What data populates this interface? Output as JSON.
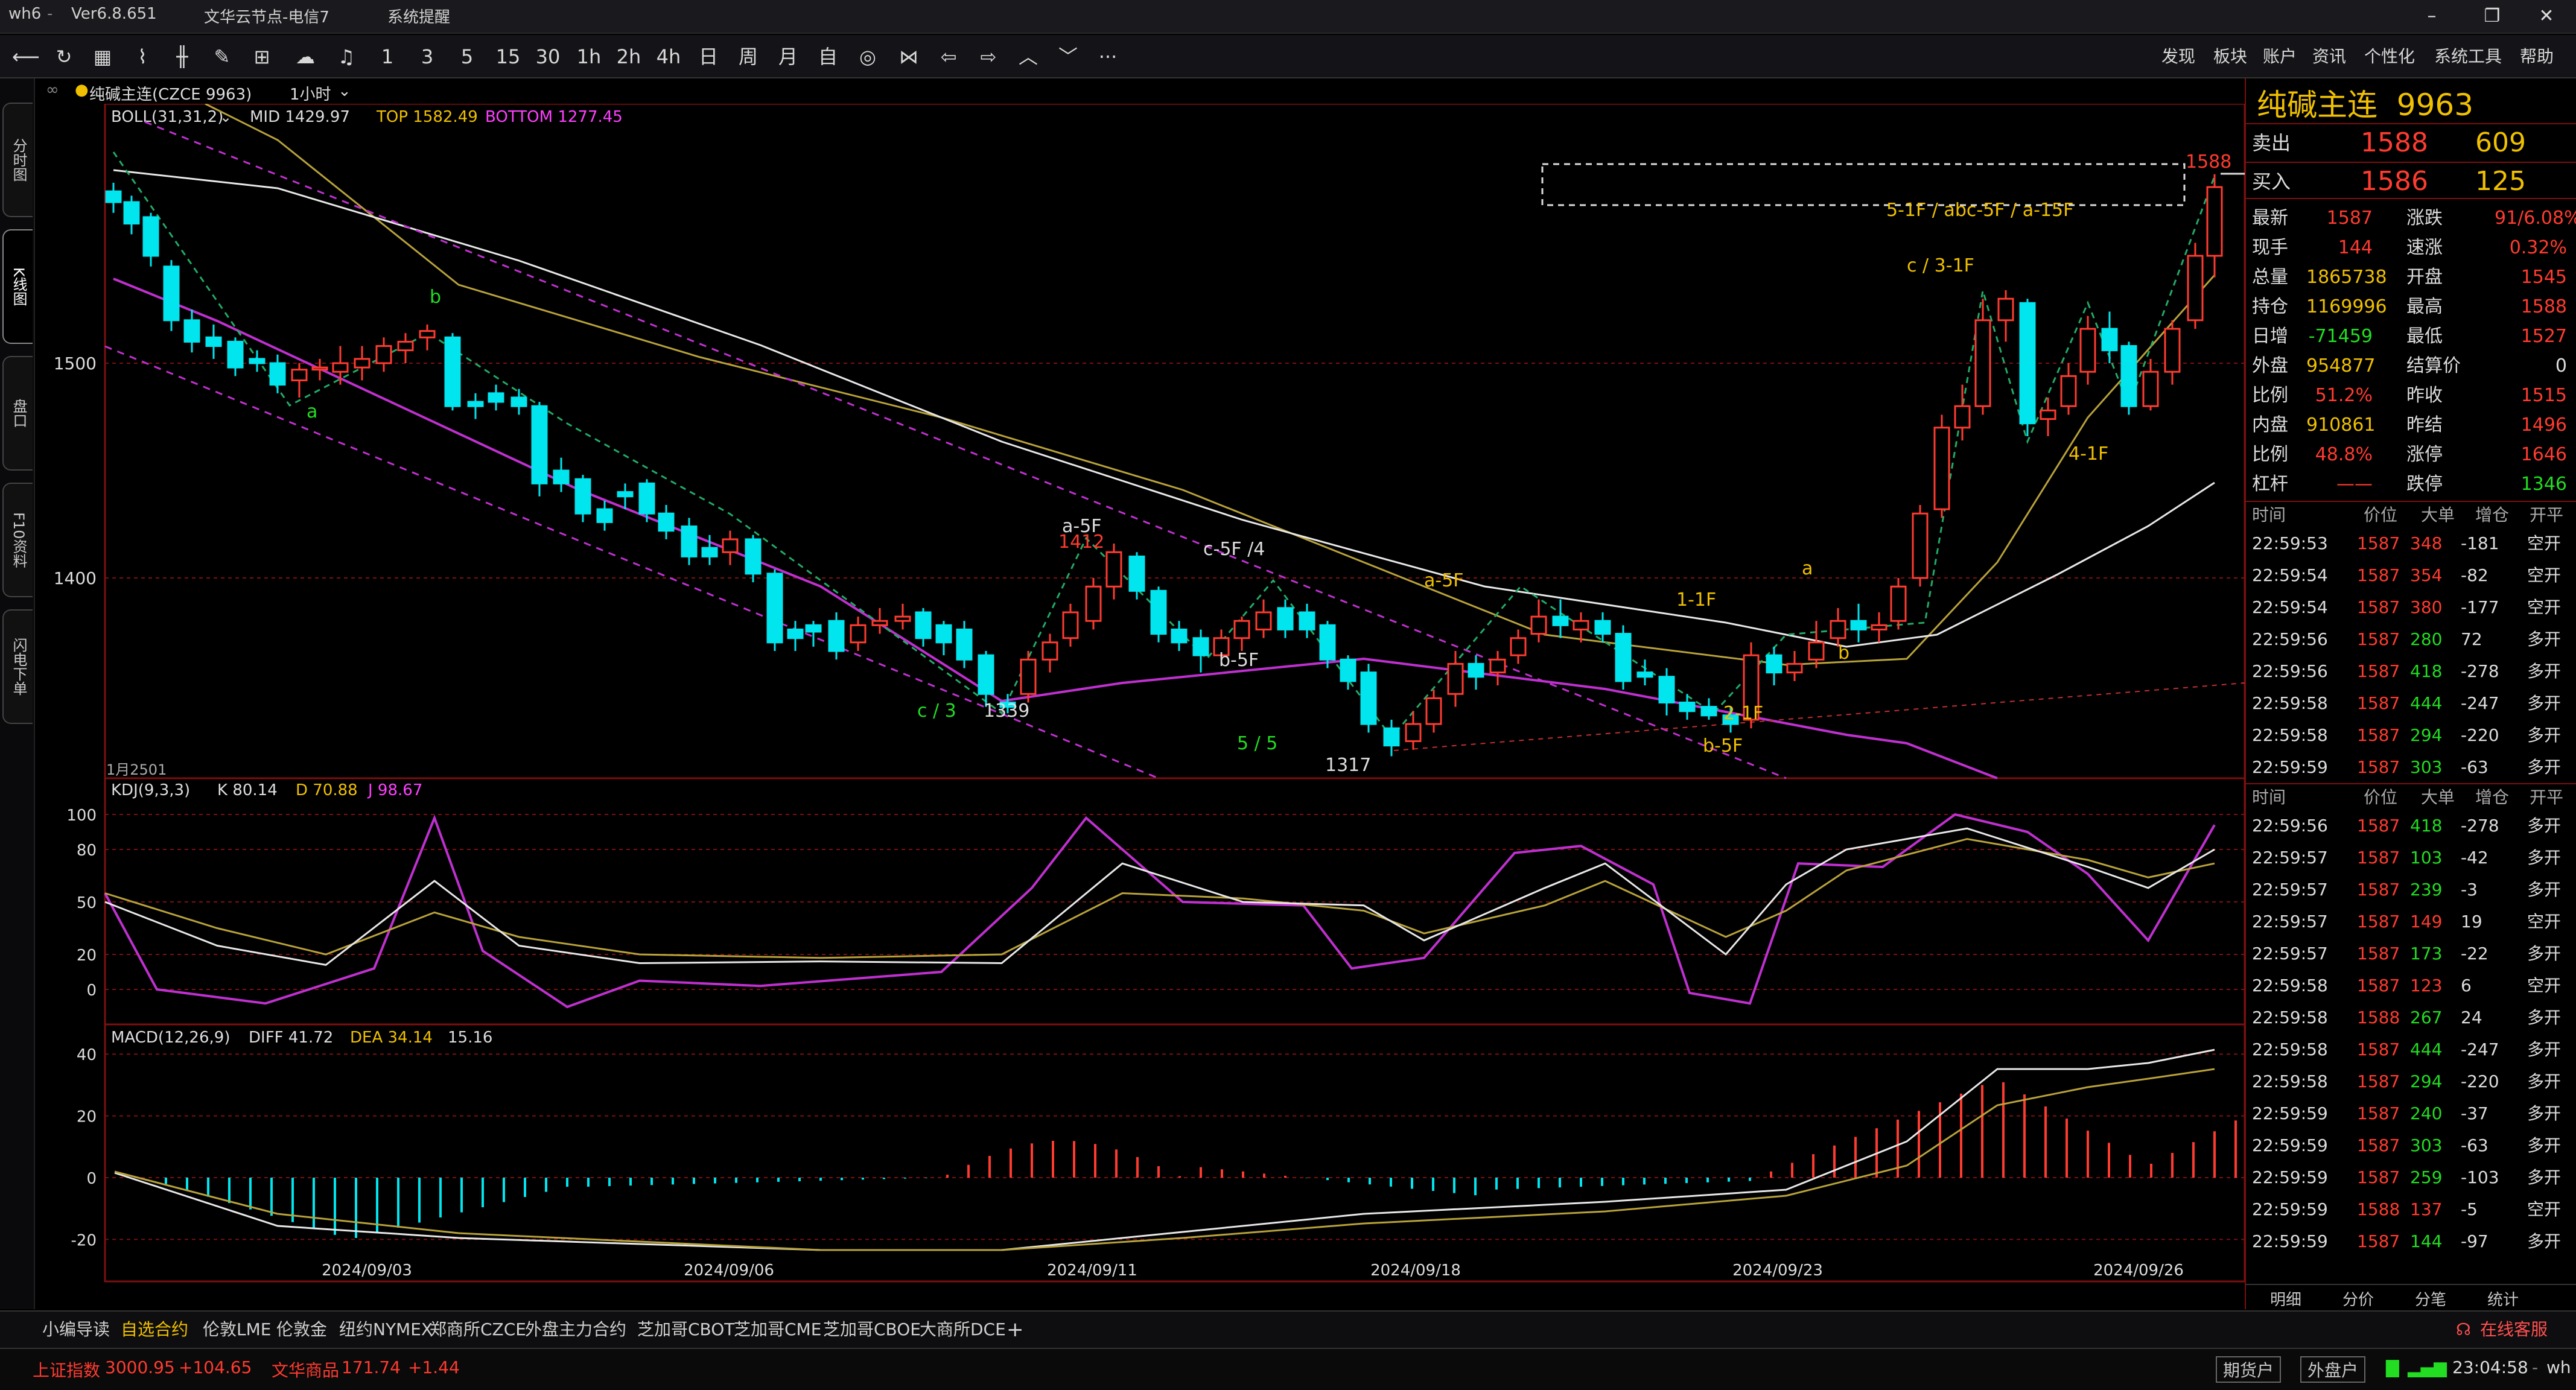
{
  "titlebar": {
    "app": "wh6",
    "version": "Ver6.8.651",
    "server": "文华云节点-电信7",
    "system": "系统提醒"
  },
  "toolbar": {
    "periods": [
      "1",
      "3",
      "5",
      "15",
      "30",
      "1h",
      "2h",
      "4h",
      "日",
      "周",
      "月",
      "自"
    ],
    "ellipsis": "···",
    "menus": [
      "发现",
      "板块",
      "账户",
      "资讯",
      "个性化",
      "系统工具",
      "帮助"
    ]
  },
  "sidetabs": [
    "分时图",
    "K线图",
    "盘口",
    "F10资料",
    "闪电下单"
  ],
  "chart": {
    "tab": "纯碱主连(CZCE 9963)",
    "period": "1小时",
    "boll": {
      "name": "BOLL(31,31,2)",
      "mid": "MID 1429.97",
      "top": "TOP 1582.49",
      "bottom": "BOTTOM 1277.45"
    },
    "kdj": {
      "name": "KDJ(9,3,3)",
      "k": "K 80.14",
      "d": "D 70.88",
      "j": "J 98.67"
    },
    "macd": {
      "name": "MACD(12,26,9)",
      "diff": "DIFF 41.72",
      "dea": "DEA 34.14",
      "hist": "15.16"
    },
    "yaxis_main": [
      "1500",
      "1400"
    ],
    "yaxis_kdj": [
      "100",
      "80",
      "50",
      "20",
      "0"
    ],
    "yaxis_macd": [
      "40",
      "20",
      "0",
      "-20"
    ],
    "xaxis": [
      "2024/09/03",
      "2024/09/06",
      "2024/09/11",
      "2024/09/18",
      "2024/09/23",
      "2024/09/26"
    ],
    "bottom_note": "1月2501",
    "annotations": {
      "a1": "a",
      "b1": "b",
      "c3": "c / 3",
      "p1339": "1339",
      "a5f": "a-5F",
      "p1412": "1412",
      "c5f": "c-5F /4",
      "b5f": "b-5F",
      "s55": "5 / 5",
      "p1317": "1317",
      "a5f2": "a-5F",
      "f1": "1-1F",
      "f2": "2-1F",
      "b5f2": "b-5F",
      "a2": "a",
      "b2": "b",
      "c3f": "c / 3-1F",
      "wave": "5-1F / abc-5F / a-15F",
      "f4": "4-1F",
      "p1588": "1588"
    }
  },
  "quote": {
    "name": "纯碱主连",
    "code": "9963",
    "sell": {
      "label": "卖出",
      "price": "1588",
      "vol": "609"
    },
    "buy": {
      "label": "买入",
      "price": "1586",
      "vol": "125"
    },
    "stats": [
      [
        "最新",
        "1587",
        "涨跌",
        "91/6.08%"
      ],
      [
        "现手",
        "144",
        "速涨",
        "0.32%"
      ],
      [
        "总量",
        "1865738",
        "开盘",
        "1545"
      ],
      [
        "持仓",
        "1169996",
        "最高",
        "1588"
      ],
      [
        "日增",
        "-71459",
        "最低",
        "1527"
      ],
      [
        "外盘",
        "954877",
        "结算价",
        "0"
      ],
      [
        "比例",
        "51.2%",
        "昨收",
        "1515"
      ],
      [
        "内盘",
        "910861",
        "昨结",
        "1496"
      ],
      [
        "比例",
        "48.8%",
        "涨停",
        "1646"
      ],
      [
        "杠杆",
        "——",
        "跌停",
        "1346"
      ]
    ],
    "th": [
      "时间",
      "价位",
      "大单",
      "增仓",
      "开平"
    ],
    "trades1": [
      [
        "22:59:53",
        "1587",
        "348",
        "-181",
        "空开"
      ],
      [
        "22:59:54",
        "1587",
        "354",
        "-82",
        "空开"
      ],
      [
        "22:59:54",
        "1587",
        "380",
        "-177",
        "空开"
      ],
      [
        "22:59:56",
        "1587",
        "280",
        "72",
        "多开"
      ],
      [
        "22:59:56",
        "1587",
        "418",
        "-278",
        "多开"
      ],
      [
        "22:59:58",
        "1587",
        "444",
        "-247",
        "多开"
      ],
      [
        "22:59:58",
        "1587",
        "294",
        "-220",
        "多开"
      ],
      [
        "22:59:59",
        "1587",
        "303",
        "-63",
        "多开"
      ]
    ],
    "th2": [
      "时间",
      "价位",
      "大单",
      "增仓",
      "开平"
    ],
    "trades2": [
      [
        "22:59:56",
        "1587",
        "418",
        "-278",
        "多开"
      ],
      [
        "22:59:57",
        "1587",
        "103",
        "-42",
        "多开"
      ],
      [
        "22:59:57",
        "1587",
        "239",
        "-3",
        "多开"
      ],
      [
        "22:59:57",
        "1587",
        "149",
        "19",
        "空开"
      ],
      [
        "22:59:57",
        "1587",
        "173",
        "-22",
        "多开"
      ],
      [
        "22:59:58",
        "1587",
        "123",
        "6",
        "空开"
      ],
      [
        "22:59:58",
        "1588",
        "267",
        "24",
        "多开"
      ],
      [
        "22:59:58",
        "1587",
        "444",
        "-247",
        "多开"
      ],
      [
        "22:59:58",
        "1587",
        "294",
        "-220",
        "多开"
      ],
      [
        "22:59:59",
        "1587",
        "240",
        "-37",
        "多开"
      ],
      [
        "22:59:59",
        "1587",
        "303",
        "-63",
        "多开"
      ],
      [
        "22:59:59",
        "1587",
        "259",
        "-103",
        "多开"
      ],
      [
        "22:59:59",
        "1588",
        "137",
        "-5",
        "空开"
      ],
      [
        "22:59:59",
        "1587",
        "144",
        "-97",
        "多开"
      ]
    ],
    "bottom_tabs": [
      "明细",
      "分价",
      "分笔",
      "统计"
    ]
  },
  "bottom_tabs": [
    "小编导读",
    "自选合约",
    "伦敦LME",
    "伦敦金",
    "纽约NYMEX",
    "郑商所CZCE",
    "外盘主力合约",
    "芝加哥CBOT",
    "芝加哥CME",
    "芝加哥CBOE",
    "大商所DCE",
    "+"
  ],
  "online_service": "在线客服",
  "status": {
    "idx1_name": "上证指数",
    "idx1_val": "3000.95",
    "idx1_chg": "+104.65",
    "idx2_name": "文华商品",
    "idx2_val": "171.74",
    "idx2_chg": "+1.44",
    "btn1": "期货户",
    "btn2": "外盘户",
    "time": "23:04:58",
    "user": "wh"
  },
  "colors": {
    "up": "#ff3b30",
    "down": "#00e5ee",
    "boll_top": "#b8a23a",
    "boll_mid": "#e8e8e8",
    "boll_bot": "#c030d0",
    "grid": "#7a1010"
  }
}
